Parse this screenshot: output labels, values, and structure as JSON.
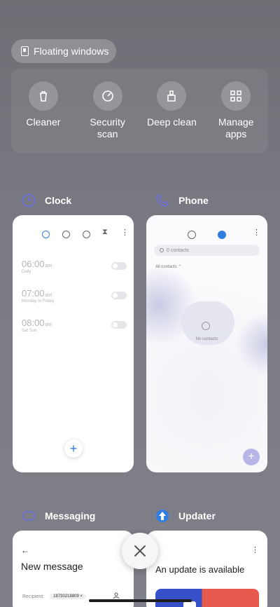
{
  "floating_windows": {
    "label": "Floating windows"
  },
  "tools": [
    {
      "label": "Cleaner",
      "icon": "trash-icon"
    },
    {
      "label": "Security\nscan",
      "icon": "shield-scan-icon"
    },
    {
      "label": "Deep clean",
      "icon": "broom-icon"
    },
    {
      "label": "Manage\napps",
      "icon": "grid-icon"
    }
  ],
  "apps": {
    "clock": {
      "name": "Clock",
      "alarms": [
        {
          "time": "06:00",
          "ampm": "am",
          "sub": "Daily"
        },
        {
          "time": "07:00",
          "ampm": "am",
          "sub": "Monday to Friday"
        },
        {
          "time": "08:00",
          "ampm": "am",
          "sub": "Sat Sun"
        }
      ]
    },
    "phone": {
      "name": "Phone",
      "search_placeholder": "0 contacts",
      "filter": "All contacts",
      "empty": "No contacts"
    },
    "messaging": {
      "name": "Messaging",
      "title": "New message",
      "recipient_label": "Recipient:",
      "recipient_value": "18730218809"
    },
    "updater": {
      "name": "Updater",
      "title": "An update is available"
    }
  },
  "colors": {
    "accent": "#2f7de1",
    "phone_fab": "#b7b6e6"
  }
}
